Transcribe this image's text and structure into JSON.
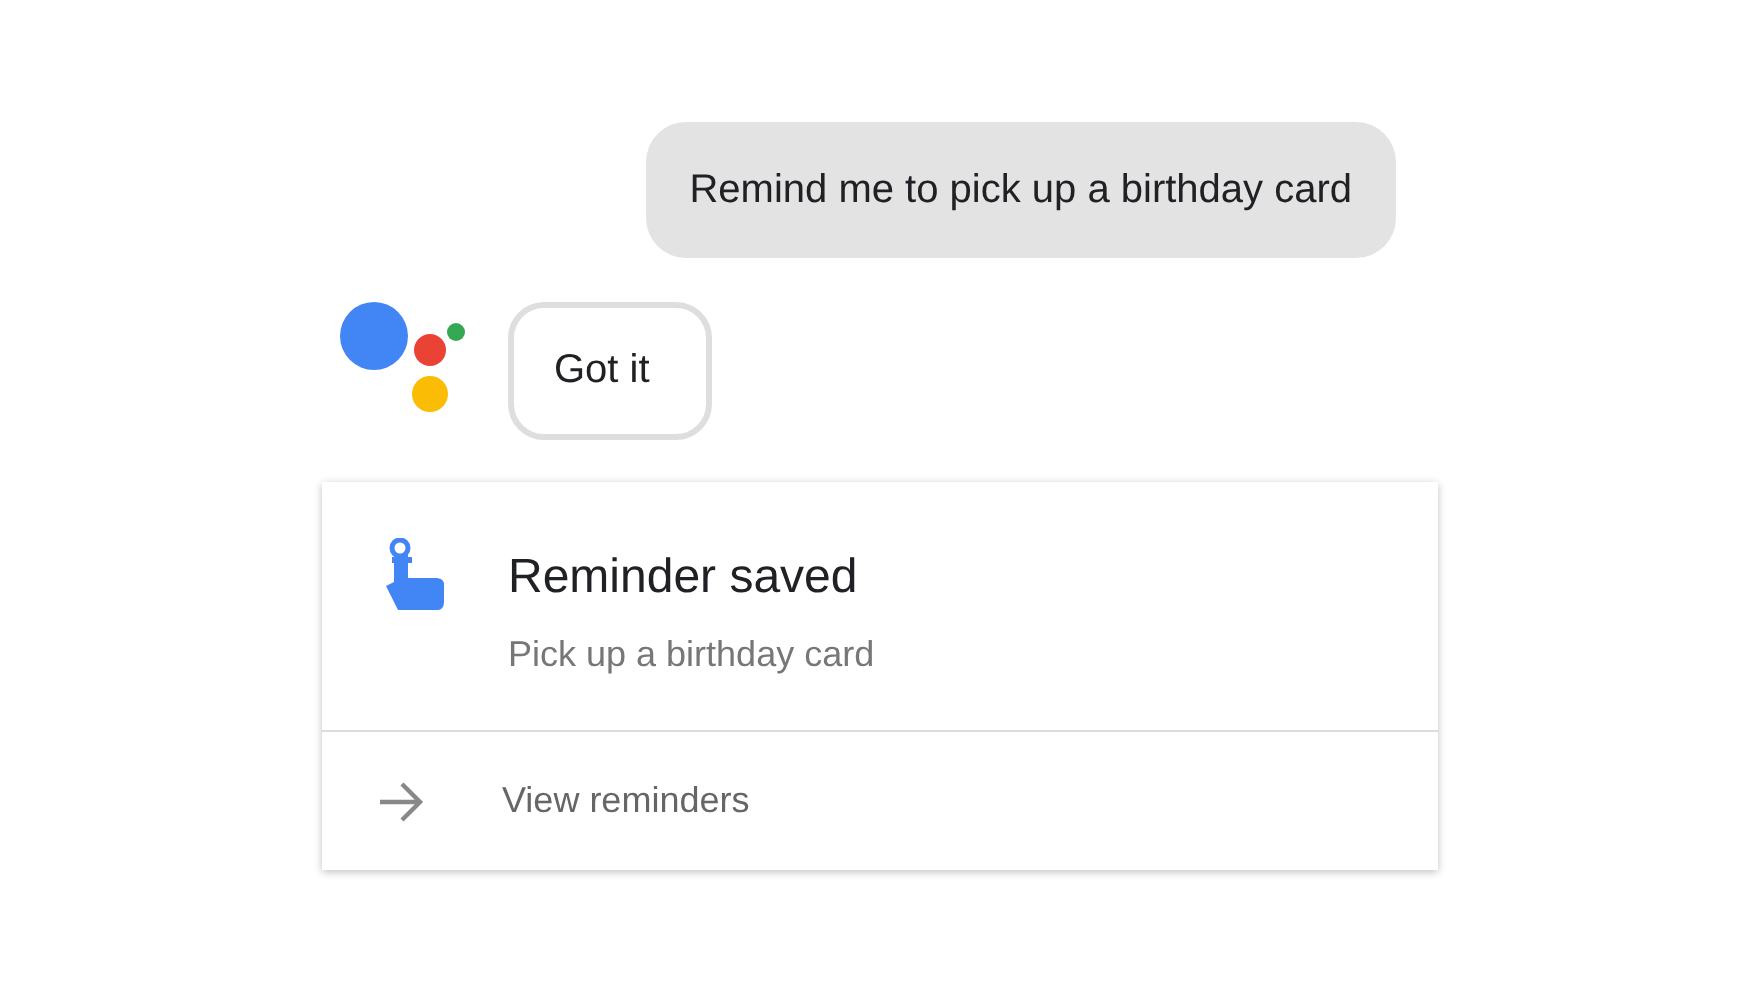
{
  "user_message": "Remind me to pick up a birthday card",
  "assistant_reply": "Got it",
  "card": {
    "title": "Reminder saved",
    "subtitle": "Pick up a birthday card",
    "action": "View reminders"
  }
}
